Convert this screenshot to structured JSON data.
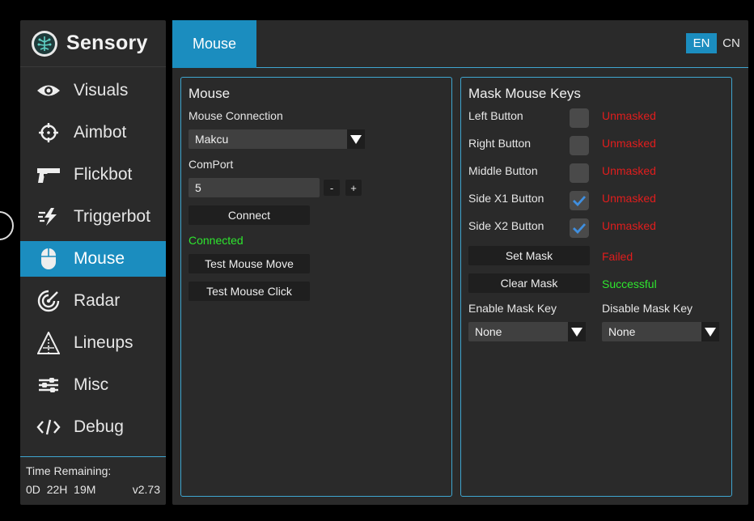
{
  "app": {
    "name": "Sensory"
  },
  "sidebar": {
    "items": [
      {
        "label": "Visuals",
        "icon": "eye-icon"
      },
      {
        "label": "Aimbot",
        "icon": "crosshair-icon"
      },
      {
        "label": "Flickbot",
        "icon": "pistol-icon"
      },
      {
        "label": "Triggerbot",
        "icon": "lightning-lines-icon"
      },
      {
        "label": "Mouse",
        "icon": "mouse-icon",
        "active": true
      },
      {
        "label": "Radar",
        "icon": "radar-icon"
      },
      {
        "label": "Lineups",
        "icon": "tent-icon"
      },
      {
        "label": "Misc",
        "icon": "sliders-icon"
      },
      {
        "label": "Debug",
        "icon": "code-icon"
      }
    ],
    "footer": {
      "time_label": "Time Remaining:",
      "days": "0D",
      "hours": "22H",
      "minutes": "19M",
      "version": "v2.73"
    }
  },
  "header": {
    "tab": "Mouse",
    "languages": [
      "EN",
      "CN"
    ],
    "active_language": "EN"
  },
  "mouse_panel": {
    "title": "Mouse",
    "connection_label": "Mouse Connection",
    "connection_value": "Makcu",
    "comport_label": "ComPort",
    "comport_value": "5",
    "decrement_label": "-",
    "increment_label": "+",
    "connect_button": "Connect",
    "connection_status": "Connected",
    "test_move_button": "Test Mouse Move",
    "test_click_button": "Test Mouse Click"
  },
  "mask_panel": {
    "title": "Mask Mouse Keys",
    "keys": [
      {
        "label": "Left Button",
        "checked": false,
        "status": "Unmasked"
      },
      {
        "label": "Right Button",
        "checked": false,
        "status": "Unmasked"
      },
      {
        "label": "Middle Button",
        "checked": false,
        "status": "Unmasked"
      },
      {
        "label": "Side X1 Button",
        "checked": true,
        "status": "Unmasked"
      },
      {
        "label": "Side X2 Button",
        "checked": true,
        "status": "Unmasked"
      }
    ],
    "set_mask_button": "Set Mask",
    "set_mask_status": "Failed",
    "clear_mask_button": "Clear Mask",
    "clear_mask_status": "Successful",
    "enable_key_label": "Enable Mask Key",
    "enable_key_value": "None",
    "disable_key_label": "Disable Mask Key",
    "disable_key_value": "None"
  },
  "colors": {
    "accent": "#1b8dbf",
    "success": "#2ee62e",
    "error": "#e11d1d",
    "panel_bg": "#2a2a2a",
    "check": "#3f8fe0"
  }
}
